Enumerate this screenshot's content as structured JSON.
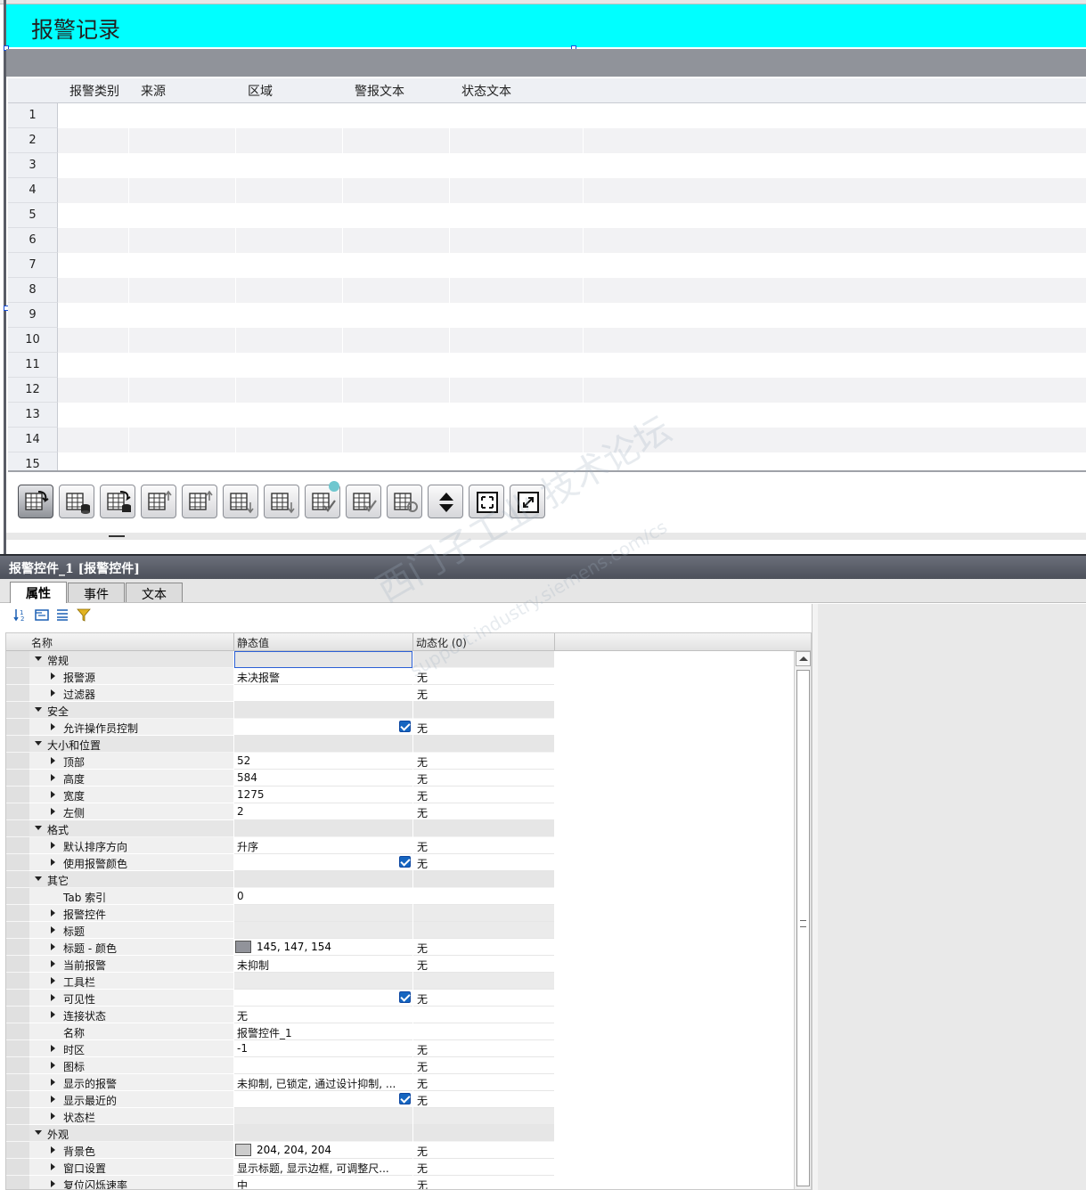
{
  "screen_title": "报警记录",
  "alarm_table": {
    "columns": [
      "报警类别",
      "来源",
      "区域",
      "警报文本",
      "状态文本"
    ],
    "rows": [
      "1",
      "2",
      "3",
      "4",
      "5",
      "6",
      "7",
      "8",
      "9",
      "10",
      "11",
      "12",
      "13",
      "14",
      "15"
    ]
  },
  "toolbar": {
    "buttons": [
      {
        "name": "current-alarms-button",
        "icon": "table-arrow-icon"
      },
      {
        "name": "alarm-buffer-button",
        "icon": "table-db-icon"
      },
      {
        "name": "alarm-log-button",
        "icon": "table-db2-icon"
      },
      {
        "name": "first-row-button",
        "icon": "table-up-icon"
      },
      {
        "name": "prev-row-button",
        "icon": "table-up2-icon"
      },
      {
        "name": "next-row-button",
        "icon": "table-down-icon"
      },
      {
        "name": "last-row-button",
        "icon": "table-down2-icon"
      },
      {
        "name": "acknowledge-button",
        "icon": "table-check-icon"
      },
      {
        "name": "group-acknowledge-button",
        "icon": "table-check2-icon"
      },
      {
        "name": "loop-in-alarm-button",
        "icon": "table-refresh-icon"
      },
      {
        "name": "sort-button",
        "icon": "sort-arrows-icon"
      },
      {
        "name": "info-text-button",
        "icon": "frame-icon"
      },
      {
        "name": "scroll-button",
        "icon": "frame-arrows-icon"
      }
    ]
  },
  "panel": {
    "title": "报警控件_1 [报警控件]",
    "tabs": [
      "属性",
      "事件",
      "文本"
    ],
    "columns": {
      "name": "名称",
      "static": "静态值",
      "dynamic": "动态化 (0)"
    },
    "rows": [
      {
        "level": 0,
        "label": "常规",
        "expand": "down",
        "group": true,
        "value": "",
        "dyn": "",
        "check": false
      },
      {
        "level": 1,
        "label": "报警源",
        "expand": "right",
        "value": "未决报警",
        "dyn": "无",
        "check": false
      },
      {
        "level": 1,
        "label": "过滤器",
        "expand": "right",
        "value": "",
        "dyn": "无",
        "check": false
      },
      {
        "level": 0,
        "label": "安全",
        "expand": "down",
        "group": true,
        "value": "",
        "dyn": "",
        "check": false
      },
      {
        "level": 1,
        "label": "允许操作员控制",
        "expand": "right",
        "value": "",
        "dyn": "无",
        "check": true
      },
      {
        "level": 0,
        "label": "大小和位置",
        "expand": "down",
        "group": true,
        "value": "",
        "dyn": "",
        "check": false
      },
      {
        "level": 1,
        "label": "顶部",
        "expand": "right",
        "value": "52",
        "dyn": "无",
        "check": false
      },
      {
        "level": 1,
        "label": "高度",
        "expand": "right",
        "value": "584",
        "dyn": "无",
        "check": false
      },
      {
        "level": 1,
        "label": "宽度",
        "expand": "right",
        "value": "1275",
        "dyn": "无",
        "check": false
      },
      {
        "level": 1,
        "label": "左侧",
        "expand": "right",
        "value": "2",
        "dyn": "无",
        "check": false
      },
      {
        "level": 0,
        "label": "格式",
        "expand": "down",
        "group": true,
        "value": "",
        "dyn": "",
        "check": false
      },
      {
        "level": 1,
        "label": "默认排序方向",
        "expand": "right",
        "value": "升序",
        "dyn": "无",
        "check": false
      },
      {
        "level": 1,
        "label": "使用报警颜色",
        "expand": "right",
        "value": "",
        "dyn": "无",
        "check": true
      },
      {
        "level": 0,
        "label": "其它",
        "expand": "down",
        "group": true,
        "value": "",
        "dyn": "",
        "check": false
      },
      {
        "level": 1,
        "label": "Tab 索引",
        "expand": "none",
        "value": "0",
        "dyn": "",
        "check": false
      },
      {
        "level": 1,
        "label": "报警控件",
        "expand": "right",
        "value": "",
        "dyn": "",
        "check": false,
        "shaded": true
      },
      {
        "level": 1,
        "label": "标题",
        "expand": "right",
        "value": "",
        "dyn": "",
        "check": false,
        "shaded": true
      },
      {
        "level": 1,
        "label": "标题 - 颜色",
        "expand": "right",
        "value": "145, 147, 154",
        "swatch": "#91939a",
        "dyn": "无",
        "check": false
      },
      {
        "level": 1,
        "label": "当前报警",
        "expand": "right",
        "value": "未抑制",
        "dyn": "无",
        "check": false
      },
      {
        "level": 1,
        "label": "工具栏",
        "expand": "right",
        "value": "",
        "dyn": "",
        "check": false,
        "shaded": true
      },
      {
        "level": 1,
        "label": "可见性",
        "expand": "right",
        "value": "",
        "dyn": "无",
        "check": true
      },
      {
        "level": 1,
        "label": "连接状态",
        "expand": "right",
        "value": "无",
        "dyn": "",
        "check": false
      },
      {
        "level": 1,
        "label": "名称",
        "expand": "none",
        "value": "报警控件_1",
        "dyn": "",
        "check": false
      },
      {
        "level": 1,
        "label": "时区",
        "expand": "right",
        "value": "-1",
        "dyn": "无",
        "check": false
      },
      {
        "level": 1,
        "label": "图标",
        "expand": "right",
        "value": "",
        "dyn": "无",
        "check": false
      },
      {
        "level": 1,
        "label": "显示的报警",
        "expand": "right",
        "value": "未抑制, 已锁定, 通过设计抑制, ...",
        "dyn": "无",
        "check": false
      },
      {
        "level": 1,
        "label": "显示最近的",
        "expand": "right",
        "value": "",
        "dyn": "无",
        "check": true
      },
      {
        "level": 1,
        "label": "状态栏",
        "expand": "right",
        "value": "",
        "dyn": "",
        "check": false,
        "shaded": true
      },
      {
        "level": 0,
        "label": "外观",
        "expand": "down",
        "group": true,
        "value": "",
        "dyn": "",
        "check": false
      },
      {
        "level": 1,
        "label": "背景色",
        "expand": "right",
        "value": "204, 204, 204",
        "swatch": "#cccccc",
        "dyn": "无",
        "check": false
      },
      {
        "level": 1,
        "label": "窗口设置",
        "expand": "right",
        "value": "显示标题, 显示边框, 可调整尺...",
        "dyn": "无",
        "check": false
      },
      {
        "level": 1,
        "label": "复位闪烁速率",
        "expand": "right",
        "value": "中",
        "dyn": "无",
        "check": false
      }
    ]
  },
  "watermark": {
    "line1": "西门子工业 技术论坛",
    "line2": "support.industry.siemens.com/cs"
  },
  "colors": {
    "title_bar": "#00ffff",
    "header_band": "#90939a",
    "checkbox": "#1565c0"
  }
}
